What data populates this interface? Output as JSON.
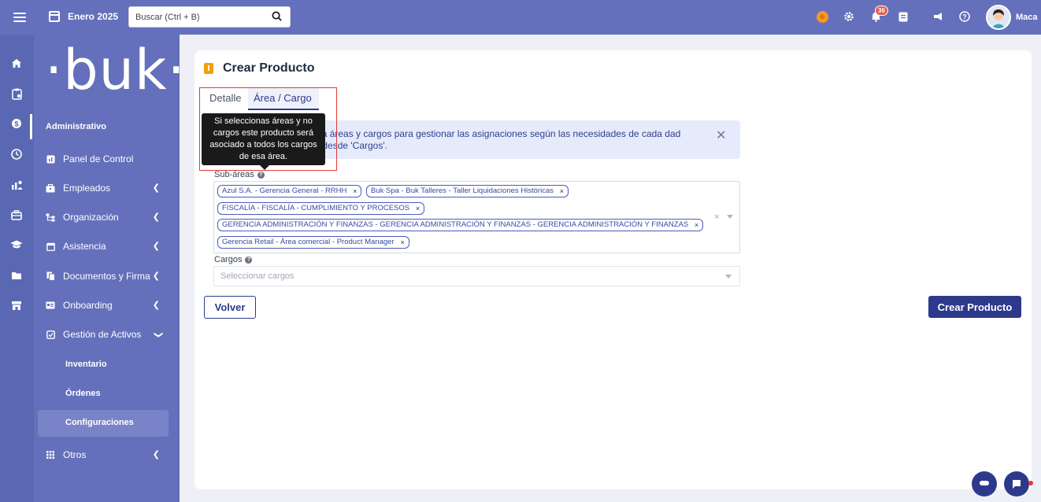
{
  "topbar": {
    "month": "Enero 2025",
    "search_placeholder": "Buscar (Ctrl + B)",
    "notification_count": "36",
    "user_name": "Maca"
  },
  "sidebar": {
    "logo": "·buk·",
    "section_title": "Administrativo",
    "items": [
      {
        "label": "Panel de Control",
        "icon": "dashboard-icon"
      },
      {
        "label": "Empleados",
        "icon": "briefcase-icon"
      },
      {
        "label": "Organización",
        "icon": "org-chart-icon"
      },
      {
        "label": "Asistencia",
        "icon": "calendar-icon"
      },
      {
        "label": "Documentos y Firma",
        "icon": "documents-icon"
      },
      {
        "label": "Onboarding",
        "icon": "onboarding-icon"
      },
      {
        "label": "Gestión de Activos",
        "icon": "assets-icon"
      }
    ],
    "sub_items": [
      "Inventario",
      "Órdenes",
      "Configuraciones"
    ],
    "other": "Otros"
  },
  "page": {
    "title": "Crear Producto",
    "tabs": [
      "Detalle",
      "Área / Cargo"
    ],
    "alert_text": "ductos a áreas y cargos para gestionar las asignaciones según las necesidades de cada dad directa desde 'Cargos'.",
    "tooltip": "Si seleccionas áreas y no cargos este producto será asociado a todos los cargos de esa área.",
    "subareas_label": "Sub-áreas",
    "subareas": [
      "Azul S.A. - Gerencia General - RRHH",
      "Buk Spa - Buk Talleres - Taller Liquidaciones Históricas",
      "FISCALÍA - FISCALÍA - CUMPLIMIENTO Y PROCESOS",
      "GERENCIA ADMINISTRACIÓN Y FINANZAS - GERENCIA ADMINISTRACIÓN Y FINANZAS - GERENCIA ADMINISTRACIÓN Y FINANZAS",
      "Gerencia Retail - Área comercial - Product Manager"
    ],
    "cargos_label": "Cargos",
    "cargos_placeholder": "Seleccionar cargos",
    "back_button": "Volver",
    "create_button": "Crear Producto"
  }
}
